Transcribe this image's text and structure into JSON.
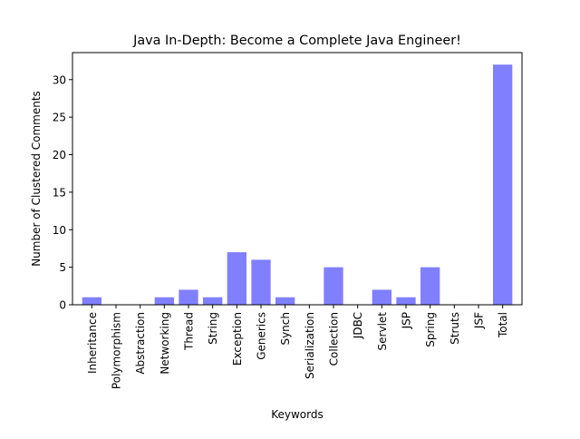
{
  "chart_data": {
    "type": "bar",
    "title": "Java In-Depth: Become a Complete Java Engineer!",
    "xlabel": "Keywords",
    "ylabel": "Number of Clustered Comments",
    "categories": [
      "Inheritance",
      "Polymorphism",
      "Abstraction",
      "Networking",
      "Thread",
      "String",
      "Exception",
      "Generics",
      "Synch",
      "Serialization",
      "Collection",
      "JDBC",
      "Servlet",
      "JSP",
      "Spring",
      "Struts",
      "JSF",
      "Total"
    ],
    "values": [
      1,
      0,
      0,
      1,
      2,
      1,
      7,
      6,
      1,
      0,
      5,
      0,
      2,
      1,
      5,
      0,
      0,
      32
    ],
    "ylim": [
      0,
      33.6
    ],
    "yticks": [
      0,
      5,
      10,
      15,
      20,
      25,
      30
    ],
    "bar_color": "#8080ff",
    "grid": false,
    "legend": "none"
  }
}
